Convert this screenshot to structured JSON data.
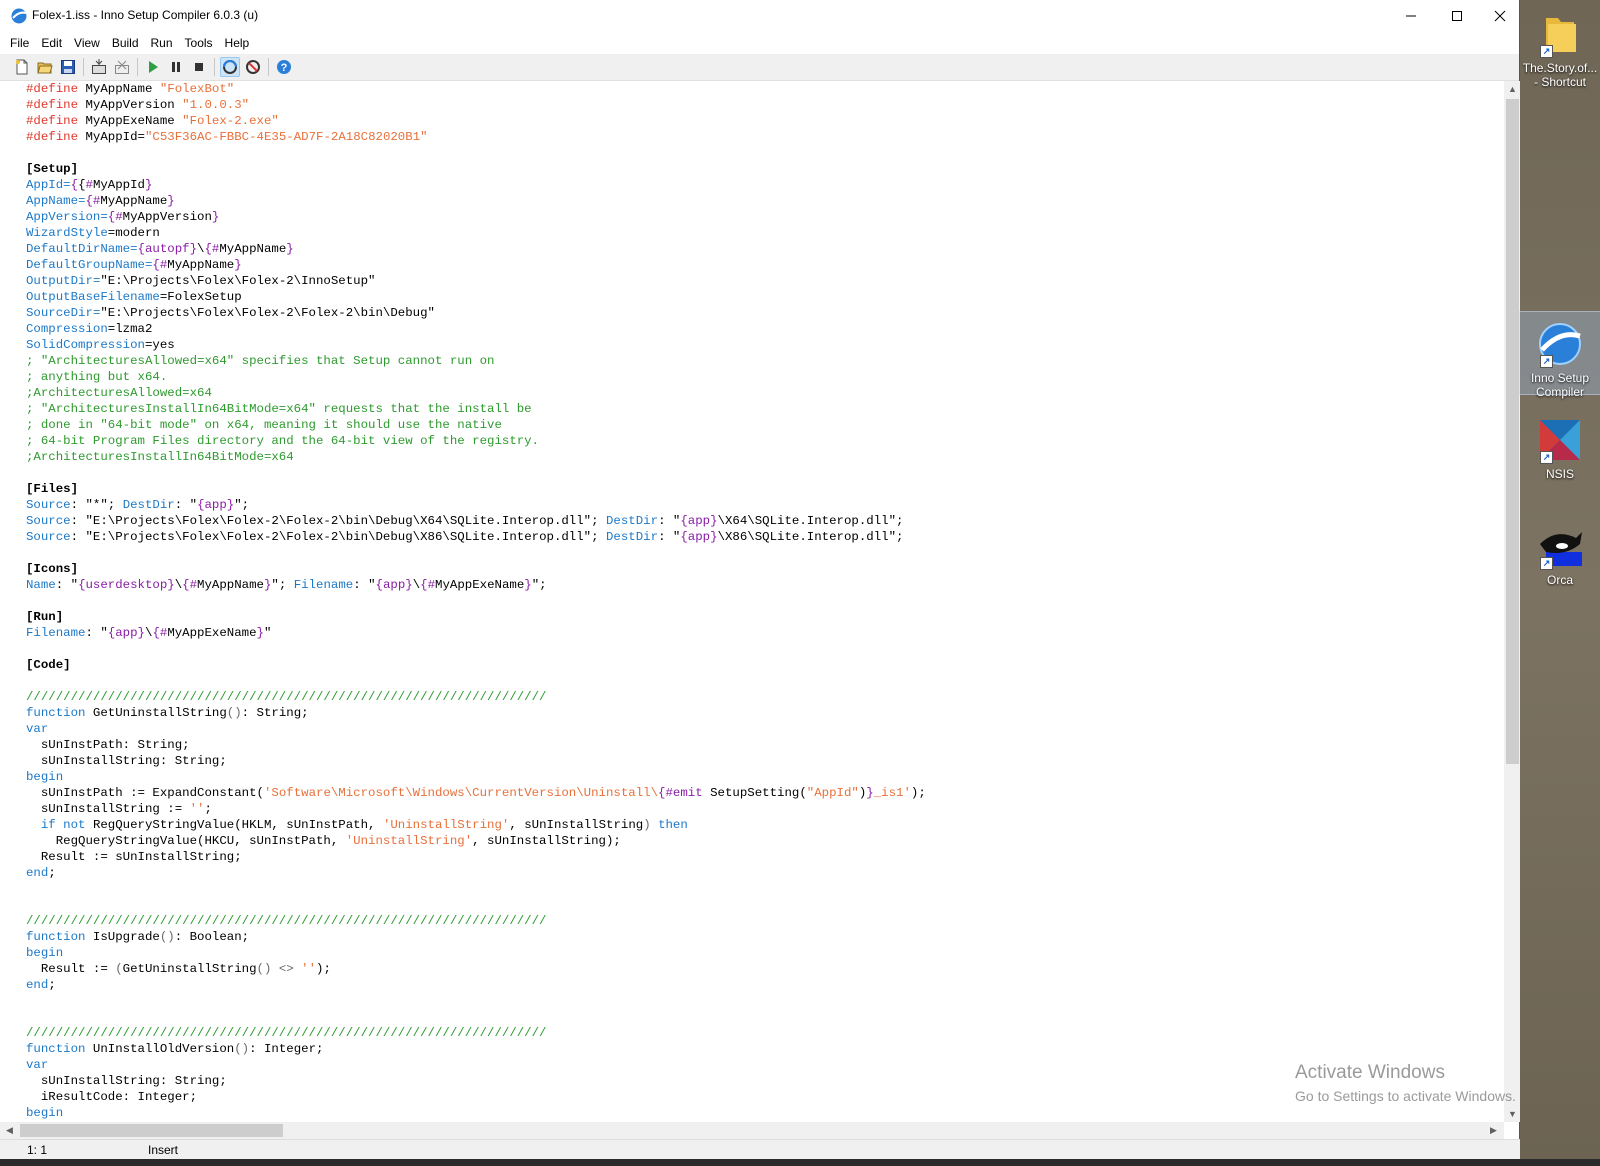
{
  "window": {
    "title": "Folex-1.iss - Inno Setup Compiler 6.0.3 (u)",
    "controls": {
      "minimize": "—",
      "maximize": "☐",
      "close": "✕"
    }
  },
  "menu": [
    "File",
    "Edit",
    "View",
    "Build",
    "Run",
    "Tools",
    "Help"
  ],
  "toolbar": {
    "buttons": [
      {
        "name": "new-file",
        "icon": "new-file-icon"
      },
      {
        "name": "open-file",
        "icon": "open-folder-icon"
      },
      {
        "name": "save-file",
        "icon": "save-icon"
      },
      {
        "name": "compile",
        "icon": "compile-icon"
      },
      {
        "name": "stop-compile",
        "icon": "stop-compile-icon"
      },
      {
        "name": "run",
        "icon": "play-icon"
      },
      {
        "name": "pause",
        "icon": "pause-icon"
      },
      {
        "name": "terminate",
        "icon": "stop-icon"
      },
      {
        "name": "target-setup",
        "icon": "target-setup-icon"
      },
      {
        "name": "target-uninstall",
        "icon": "target-uninstall-icon"
      },
      {
        "name": "help",
        "icon": "help-icon"
      }
    ]
  },
  "editor": {
    "lines": [
      [
        [
          "dr",
          "#define "
        ],
        [
          "pl",
          "MyAppName "
        ],
        [
          "st",
          "\"FolexBot\""
        ]
      ],
      [
        [
          "dr",
          "#define "
        ],
        [
          "pl",
          "MyAppVersion "
        ],
        [
          "st",
          "\"1.0.0.3\""
        ]
      ],
      [
        [
          "dr",
          "#define "
        ],
        [
          "pl",
          "MyAppExeName "
        ],
        [
          "st",
          "\"Folex-2.exe\""
        ]
      ],
      [
        [
          "dr",
          "#define "
        ],
        [
          "pl",
          "MyAppId="
        ],
        [
          "st",
          "\"C53F36AC-FBBC-4E35-AD7F-2A18C82020B1\""
        ]
      ],
      [],
      [
        [
          "sec",
          "[Setup]"
        ]
      ],
      [
        [
          "key",
          "AppId="
        ],
        [
          "cst",
          "{"
        ],
        [
          "pl",
          "{"
        ],
        [
          "cst",
          "#"
        ],
        [
          "pl",
          "MyAppId"
        ],
        [
          "cst",
          "}"
        ]
      ],
      [
        [
          "key",
          "AppName="
        ],
        [
          "cst",
          "{#"
        ],
        [
          "pl",
          "MyAppName"
        ],
        [
          "cst",
          "}"
        ]
      ],
      [
        [
          "key",
          "AppVersion="
        ],
        [
          "cst",
          "{#"
        ],
        [
          "pl",
          "MyAppVersion"
        ],
        [
          "cst",
          "}"
        ]
      ],
      [
        [
          "key",
          "WizardStyle"
        ],
        [
          "pl",
          "=modern"
        ]
      ],
      [
        [
          "key",
          "DefaultDirName="
        ],
        [
          "cst",
          "{autopf}"
        ],
        [
          "pl",
          "\\"
        ],
        [
          "cst",
          "{#"
        ],
        [
          "pl",
          "MyAppName"
        ],
        [
          "cst",
          "}"
        ]
      ],
      [
        [
          "key",
          "DefaultGroupName="
        ],
        [
          "cst",
          "{#"
        ],
        [
          "pl",
          "MyAppName"
        ],
        [
          "cst",
          "}"
        ]
      ],
      [
        [
          "key",
          "OutputDir="
        ],
        [
          "pl",
          "\"E:\\Projects\\Folex\\Folex-2\\InnoSetup\""
        ]
      ],
      [
        [
          "key",
          "OutputBaseFilename"
        ],
        [
          "pl",
          "=FolexSetup"
        ]
      ],
      [
        [
          "key",
          "SourceDir="
        ],
        [
          "pl",
          "\"E:\\Projects\\Folex\\Folex-2\\Folex-2\\bin\\Debug\""
        ]
      ],
      [
        [
          "key",
          "Compression"
        ],
        [
          "pl",
          "=lzma2"
        ]
      ],
      [
        [
          "key",
          "SolidCompression"
        ],
        [
          "pl",
          "=yes"
        ]
      ],
      [
        [
          "cm",
          "; \"ArchitecturesAllowed=x64\" specifies that Setup cannot run on"
        ]
      ],
      [
        [
          "cm",
          "; anything but x64."
        ]
      ],
      [
        [
          "cm",
          ";ArchitecturesAllowed=x64"
        ]
      ],
      [
        [
          "cm",
          "; \"ArchitecturesInstallIn64BitMode=x64\" requests that the install be"
        ]
      ],
      [
        [
          "cm",
          "; done in \"64-bit mode\" on x64, meaning it should use the native"
        ]
      ],
      [
        [
          "cm",
          "; 64-bit Program Files directory and the 64-bit view of the registry."
        ]
      ],
      [
        [
          "cm",
          ";ArchitecturesInstallIn64BitMode=x64"
        ]
      ],
      [],
      [
        [
          "sec",
          "[Files]"
        ]
      ],
      [
        [
          "key",
          "Source"
        ],
        [
          "pl",
          ": \"*\"; "
        ],
        [
          "key",
          "DestDir"
        ],
        [
          "pl",
          ": \""
        ],
        [
          "cst",
          "{app}"
        ],
        [
          "pl",
          "\";"
        ]
      ],
      [
        [
          "key",
          "Source"
        ],
        [
          "pl",
          ": \"E:\\Projects\\Folex\\Folex-2\\Folex-2\\bin\\Debug\\X64\\SQLite.Interop.dll\"; "
        ],
        [
          "key",
          "DestDir"
        ],
        [
          "pl",
          ": \""
        ],
        [
          "cst",
          "{app}"
        ],
        [
          "pl",
          "\\X64\\SQLite.Interop.dll\";"
        ]
      ],
      [
        [
          "key",
          "Source"
        ],
        [
          "pl",
          ": \"E:\\Projects\\Folex\\Folex-2\\Folex-2\\bin\\Debug\\X86\\SQLite.Interop.dll\"; "
        ],
        [
          "key",
          "DestDir"
        ],
        [
          "pl",
          ": \""
        ],
        [
          "cst",
          "{app}"
        ],
        [
          "pl",
          "\\X86\\SQLite.Interop.dll\";"
        ]
      ],
      [],
      [
        [
          "sec",
          "[Icons]"
        ]
      ],
      [
        [
          "key",
          "Name"
        ],
        [
          "pl",
          ": \""
        ],
        [
          "cst",
          "{userdesktop}"
        ],
        [
          "pl",
          "\\"
        ],
        [
          "cst",
          "{#"
        ],
        [
          "pl",
          "MyAppName"
        ],
        [
          "cst",
          "}"
        ],
        [
          "pl",
          "\"; "
        ],
        [
          "key",
          "Filename"
        ],
        [
          "pl",
          ": \""
        ],
        [
          "cst",
          "{app}"
        ],
        [
          "pl",
          "\\"
        ],
        [
          "cst",
          "{#"
        ],
        [
          "pl",
          "MyAppExeName"
        ],
        [
          "cst",
          "}"
        ],
        [
          "pl",
          "\";"
        ]
      ],
      [],
      [
        [
          "sec",
          "[Run]"
        ]
      ],
      [
        [
          "key",
          "Filename"
        ],
        [
          "pl",
          ": \""
        ],
        [
          "cst",
          "{app}"
        ],
        [
          "pl",
          "\\"
        ],
        [
          "cst",
          "{#"
        ],
        [
          "pl",
          "MyAppExeName"
        ],
        [
          "cst",
          "}"
        ],
        [
          "pl",
          "\""
        ]
      ],
      [],
      [
        [
          "sec",
          "[Code]"
        ]
      ],
      [],
      [
        [
          "cm",
          "//////////////////////////////////////////////////////////////////////"
        ]
      ],
      [
        [
          "kw",
          "function "
        ],
        [
          "pl",
          "GetUninstallString"
        ],
        [
          "op",
          "()"
        ],
        [
          "pl",
          ": String;"
        ]
      ],
      [
        [
          "kw",
          "var"
        ]
      ],
      [
        [
          "pl",
          "  sUnInstPath: String;"
        ]
      ],
      [
        [
          "pl",
          "  sUnInstallString: String;"
        ]
      ],
      [
        [
          "kw",
          "begin"
        ]
      ],
      [
        [
          "pl",
          "  sUnInstPath := ExpandConstant("
        ],
        [
          "st",
          "'Software\\Microsoft\\Windows\\CurrentVersion\\Uninstall\\"
        ],
        [
          "cst",
          "{#emit "
        ],
        [
          "pl",
          "SetupSetting("
        ],
        [
          "st",
          "\"AppId\""
        ],
        [
          "pl",
          ")"
        ],
        [
          "cst",
          "}"
        ],
        [
          "st",
          "_is1'"
        ],
        [
          "pl",
          ");"
        ]
      ],
      [
        [
          "pl",
          "  sUnInstallString := "
        ],
        [
          "st",
          "''"
        ],
        [
          "pl",
          ";"
        ]
      ],
      [
        [
          "pl",
          "  "
        ],
        [
          "kw",
          "if not "
        ],
        [
          "pl",
          "RegQueryStringValue(HKLM, sUnInstPath, "
        ],
        [
          "st",
          "'UninstallString'"
        ],
        [
          "pl",
          ", sUnInstallString"
        ],
        [
          "op",
          ") "
        ],
        [
          "kw",
          "then"
        ]
      ],
      [
        [
          "pl",
          "    RegQueryStringValue(HKCU, sUnInstPath, "
        ],
        [
          "st",
          "'UninstallString'"
        ],
        [
          "pl",
          ", sUnInstallString);"
        ]
      ],
      [
        [
          "pl",
          "  Result := sUnInstallString;"
        ]
      ],
      [
        [
          "kw",
          "end"
        ],
        [
          "pl",
          ";"
        ]
      ],
      [],
      [],
      [
        [
          "cm",
          "//////////////////////////////////////////////////////////////////////"
        ]
      ],
      [
        [
          "kw",
          "function "
        ],
        [
          "pl",
          "IsUpgrade"
        ],
        [
          "op",
          "()"
        ],
        [
          "pl",
          ": Boolean;"
        ]
      ],
      [
        [
          "kw",
          "begin"
        ]
      ],
      [
        [
          "pl",
          "  Result := "
        ],
        [
          "op",
          "("
        ],
        [
          "pl",
          "GetUninstallString"
        ],
        [
          "op",
          "() <> "
        ],
        [
          "st",
          "''"
        ],
        [
          "pl",
          ");"
        ]
      ],
      [
        [
          "kw",
          "end"
        ],
        [
          "pl",
          ";"
        ]
      ],
      [],
      [],
      [
        [
          "cm",
          "//////////////////////////////////////////////////////////////////////"
        ]
      ],
      [
        [
          "kw",
          "function "
        ],
        [
          "pl",
          "UnInstallOldVersion"
        ],
        [
          "op",
          "()"
        ],
        [
          "pl",
          ": Integer;"
        ]
      ],
      [
        [
          "kw",
          "var"
        ]
      ],
      [
        [
          "pl",
          "  sUnInstallString: String;"
        ]
      ],
      [
        [
          "pl",
          "  iResultCode: Integer;"
        ]
      ],
      [
        [
          "kw",
          "begin"
        ]
      ]
    ]
  },
  "statusbar": {
    "position": "1:  1",
    "mode": "Insert"
  },
  "watermark": {
    "title": "Activate Windows",
    "subtitle": "Go to Settings to activate Windows."
  },
  "desktop": {
    "icons": [
      {
        "label": "The.Story.of... - Shortcut",
        "icon": "folder-icon"
      },
      {
        "label": "Inno Setup Compiler",
        "icon": "inno-setup-icon"
      },
      {
        "label": "NSIS",
        "icon": "nsis-icon"
      },
      {
        "label": "Orca",
        "icon": "orca-icon"
      }
    ]
  },
  "colors": {
    "directive": "#e0392b",
    "string": "#e8703a",
    "key": "#1c79c9",
    "constant": "#8b1da6",
    "comment": "#2e9b2e"
  }
}
